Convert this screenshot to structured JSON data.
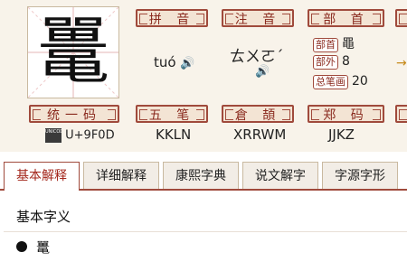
{
  "character": {
    "glyph": "鼍"
  },
  "headers": {
    "pinyin": "拼 音",
    "zhuyin": "注 音",
    "bushou": "部 首",
    "unicode": "统一码",
    "wubi": "五 笔",
    "cangjie": "倉 頡",
    "zhengma": "郑 码"
  },
  "values": {
    "pinyin": "tuó",
    "zhuyin": "ㄊㄨㄛˊ",
    "bushou_label": "部首",
    "bushou_value": "黽",
    "buwai_label": "部外",
    "buwai_value": "8",
    "strokes_label": "总笔画",
    "strokes_value": "20",
    "unicode_badge": "UNICODE",
    "unicode": "U+9F0D",
    "wubi": "KKLN",
    "cangjie": "XRRWM",
    "zhengma": "JJKZ"
  },
  "tabs": [
    {
      "label": "基本解释",
      "active": true
    },
    {
      "label": "详细解释",
      "active": false
    },
    {
      "label": "康熙字典",
      "active": false
    },
    {
      "label": "说文解字",
      "active": false
    },
    {
      "label": "字源字形",
      "active": false
    }
  ],
  "content": {
    "section_title": "基本字义",
    "items": [
      "鼍"
    ]
  },
  "colors": {
    "accent": "#a04a3c",
    "header_text": "#8a2a1e",
    "speaker": "#c68a1a"
  }
}
